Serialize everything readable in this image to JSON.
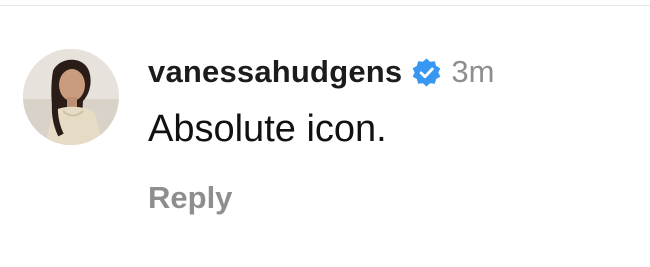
{
  "comment": {
    "username": "vanessahudgens",
    "verified": true,
    "timestamp": "3m",
    "text": "Absolute icon.",
    "reply_label": "Reply"
  },
  "colors": {
    "verified_badge": "#3897f0",
    "username": "#1c1c1c",
    "muted": "#8e8e8e",
    "divider": "#e8e8e8"
  },
  "icons": {
    "verified": "verified-badge-icon",
    "avatar": "profile-photo"
  }
}
